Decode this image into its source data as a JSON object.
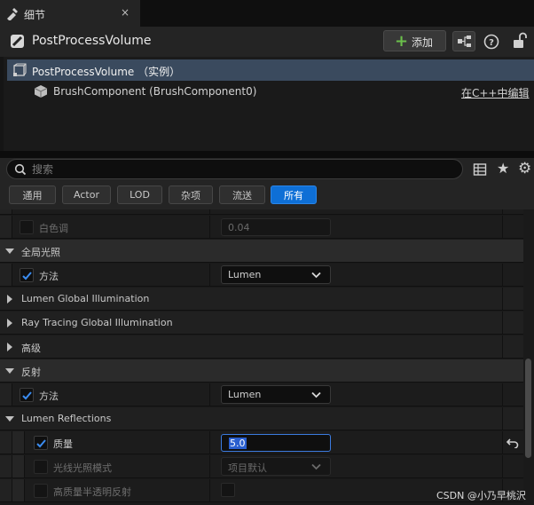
{
  "tab": {
    "title": "细节",
    "close": "×"
  },
  "header": {
    "title": "PostProcessVolume",
    "add_label": "添加"
  },
  "tree": {
    "selected": "PostProcessVolume （实例）",
    "component": "BrushComponent (BrushComponent0)",
    "edit_link": "在C++中编辑"
  },
  "search": {
    "placeholder": "搜索"
  },
  "filters": [
    "通用",
    "Actor",
    "LOD",
    "杂项",
    "流送",
    "所有"
  ],
  "active_filter": "所有",
  "properties": {
    "white_tint_label": "白色调",
    "white_tint_value": "0.04",
    "gi_category": "全局光照",
    "gi_method_label": "方法",
    "gi_method_value": "Lumen",
    "lumen_gi": "Lumen Global Illumination",
    "rt_gi": "Ray Tracing Global Illumination",
    "advanced": "高级",
    "reflections_category": "反射",
    "refl_method_label": "方法",
    "refl_method_value": "Lumen",
    "lumen_reflections": "Lumen Reflections",
    "quality_label": "质量",
    "quality_value": "5.0",
    "ray_lighting_label": "光线光照模式",
    "ray_lighting_value": "项目默认",
    "hq_translucency_label": "高质量半透明反射"
  },
  "watermark": "CSDN @小乃早桃沢",
  "colors": {
    "accent": "#0e6fd6",
    "selection": "#3a4a5e",
    "add_plus": "#6bc04b"
  }
}
